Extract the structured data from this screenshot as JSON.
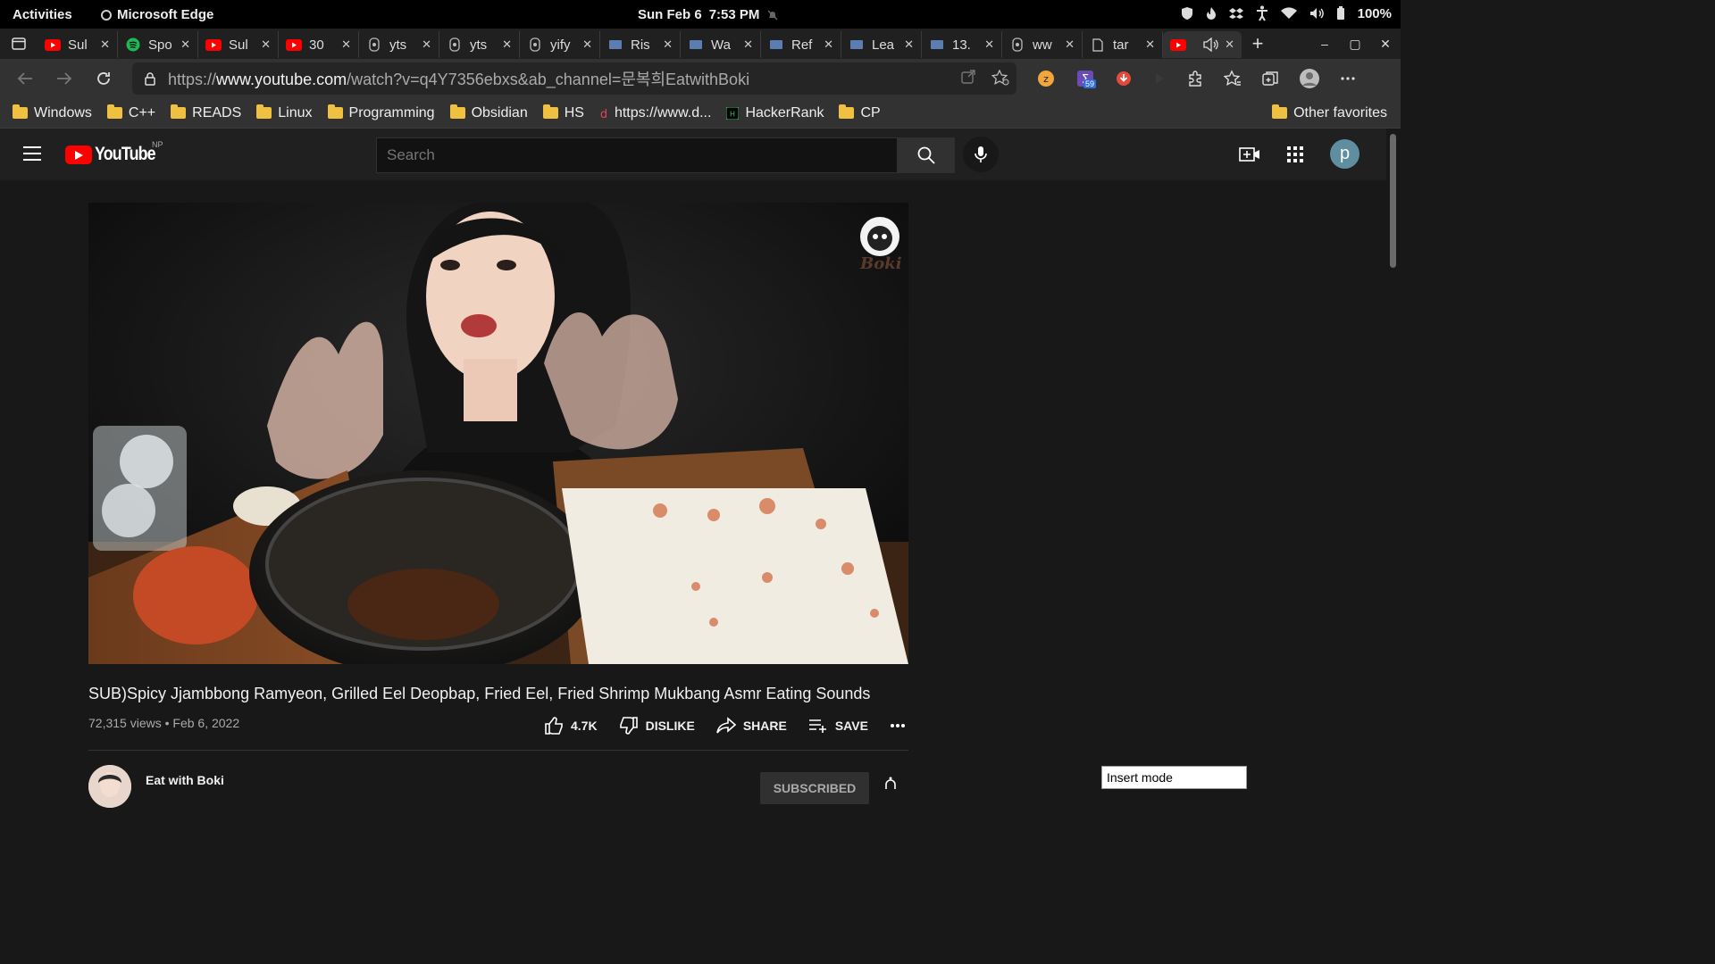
{
  "os": {
    "activities": "Activities",
    "app_name": "Microsoft Edge",
    "date": "Sun Feb 6",
    "time": "7:53 PM",
    "battery": "100%"
  },
  "tabs": [
    {
      "title": "Sul",
      "icon": "youtube-icon"
    },
    {
      "title": "Spo",
      "icon": "spotify-icon"
    },
    {
      "title": "Sul",
      "icon": "youtube-icon"
    },
    {
      "title": "30",
      "icon": "youtube-icon"
    },
    {
      "title": "yts",
      "icon": "page-icon"
    },
    {
      "title": "yts",
      "icon": "page-icon"
    },
    {
      "title": "yify",
      "icon": "page-icon"
    },
    {
      "title": "Ris",
      "icon": "site-icon"
    },
    {
      "title": "Wa",
      "icon": "site-icon"
    },
    {
      "title": "Ref",
      "icon": "site-icon"
    },
    {
      "title": "Lea",
      "icon": "site-icon"
    },
    {
      "title": "13.",
      "icon": "site-icon"
    },
    {
      "title": "ww",
      "icon": "page-icon"
    },
    {
      "title": "tar",
      "icon": "document-icon"
    },
    {
      "title": "",
      "icon": "youtube-icon",
      "active": true,
      "audio": true
    }
  ],
  "address": {
    "prefix": "https://",
    "host": "www.youtube.com",
    "path": "/watch?v=q4Y7356ebxs&ab_channel=문복희EatwithBoki"
  },
  "extension_badge": "59",
  "favorites": [
    {
      "label": "Windows",
      "type": "folder"
    },
    {
      "label": "C++",
      "type": "folder"
    },
    {
      "label": "READS",
      "type": "folder"
    },
    {
      "label": "Linux",
      "type": "folder"
    },
    {
      "label": "Programming",
      "type": "folder"
    },
    {
      "label": "Obsidian",
      "type": "folder"
    },
    {
      "label": "HS",
      "type": "folder"
    },
    {
      "label": "https://www.d...",
      "type": "link"
    },
    {
      "label": "HackerRank",
      "type": "link"
    },
    {
      "label": "CP",
      "type": "folder"
    }
  ],
  "other_favorites": "Other favorites",
  "youtube": {
    "logo_text": "YouTube",
    "region": "NP",
    "search_placeholder": "Search",
    "avatar_letter": "p",
    "video": {
      "watermark": "Boki",
      "title": "SUB)Spicy Jjambbong Ramyeon, Grilled Eel Deopbap, Fried Eel, Fried Shrimp Mukbang Asmr Eating Sounds",
      "views": "72,315 views",
      "date": "Feb 6, 2022",
      "likes": "4.7K",
      "dislike": "DISLIKE",
      "share": "SHARE",
      "save": "SAVE"
    },
    "channel": {
      "name": "Eat with Boki",
      "subscribe": "SUBSCRIBED"
    }
  },
  "insert_mode": "Insert mode",
  "colors": {
    "youtube_red": "#ff0000",
    "page_bg": "#181818",
    "header_bg": "#202020",
    "browser_chrome": "#323232"
  }
}
